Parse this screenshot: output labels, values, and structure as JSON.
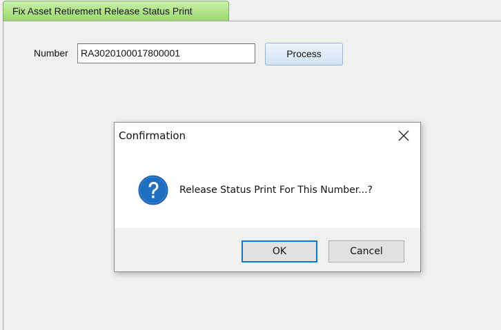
{
  "tab": {
    "title": "Fix Asset Retirement Release Status Print"
  },
  "form": {
    "number_label": "Number",
    "number_value": "RA3020100017800001",
    "process_label": "Process"
  },
  "dialog": {
    "title": "Confirmation",
    "message": "Release Status Print For This Number...?",
    "ok_label": "OK",
    "cancel_label": "Cancel",
    "icon": "question-icon",
    "close_icon": "close-icon"
  },
  "colors": {
    "tab_accent": "#9bd86f",
    "primary_focus": "#0078d7",
    "question_icon": "#1f6fc1"
  }
}
